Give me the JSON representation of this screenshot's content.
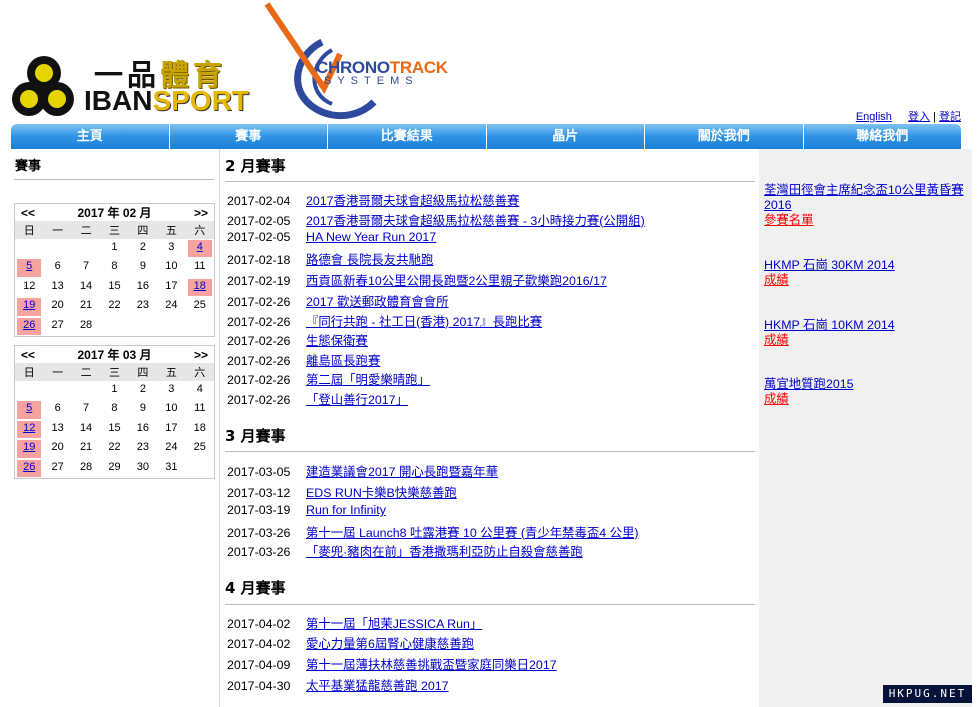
{
  "brand": {
    "iban_zh_part1": "一品",
    "iban_zh_part2": "體育",
    "iban_en_part1": "IBAN",
    "iban_en_part2": "SPORT",
    "chrono_part1": "CHRONO",
    "chrono_part2": "TRACK",
    "chrono_sub": "SYSTEMS",
    "colors": {
      "nav": "#2f93e4",
      "iban_gold": "#e4b800",
      "chrono_blue": "#2e4a9e",
      "chrono_orange": "#e96a16"
    }
  },
  "top_links": {
    "english": "English",
    "login": "登入",
    "separator": "|",
    "register": "登記"
  },
  "nav": [
    "主頁",
    "賽事",
    "比賽結果",
    "晶片",
    "關於我們",
    "聯絡我們"
  ],
  "left": {
    "heading": "賽事",
    "calendars": [
      {
        "prev": "<<",
        "next": ">>",
        "title": "2017 年 02 月",
        "weekdays": [
          "日",
          "一",
          "二",
          "三",
          "四",
          "五",
          "六"
        ],
        "cells": [
          {
            "d": ""
          },
          {
            "d": ""
          },
          {
            "d": ""
          },
          {
            "d": "1"
          },
          {
            "d": "2"
          },
          {
            "d": "3"
          },
          {
            "d": "4",
            "ev": true
          },
          {
            "d": "5",
            "ev": true
          },
          {
            "d": "6"
          },
          {
            "d": "7"
          },
          {
            "d": "8"
          },
          {
            "d": "9"
          },
          {
            "d": "10"
          },
          {
            "d": "11"
          },
          {
            "d": "12"
          },
          {
            "d": "13"
          },
          {
            "d": "14"
          },
          {
            "d": "15"
          },
          {
            "d": "16"
          },
          {
            "d": "17"
          },
          {
            "d": "18",
            "ev": true
          },
          {
            "d": "19",
            "ev": true
          },
          {
            "d": "20"
          },
          {
            "d": "21"
          },
          {
            "d": "22"
          },
          {
            "d": "23"
          },
          {
            "d": "24"
          },
          {
            "d": "25"
          },
          {
            "d": "26",
            "ev": true
          },
          {
            "d": "27"
          },
          {
            "d": "28"
          },
          {
            "d": ""
          },
          {
            "d": ""
          },
          {
            "d": ""
          },
          {
            "d": ""
          }
        ]
      },
      {
        "prev": "<<",
        "next": ">>",
        "title": "2017 年 03 月",
        "weekdays": [
          "日",
          "一",
          "二",
          "三",
          "四",
          "五",
          "六"
        ],
        "cells": [
          {
            "d": ""
          },
          {
            "d": ""
          },
          {
            "d": ""
          },
          {
            "d": "1"
          },
          {
            "d": "2"
          },
          {
            "d": "3"
          },
          {
            "d": "4"
          },
          {
            "d": "5",
            "ev": true
          },
          {
            "d": "6"
          },
          {
            "d": "7"
          },
          {
            "d": "8"
          },
          {
            "d": "9"
          },
          {
            "d": "10"
          },
          {
            "d": "11"
          },
          {
            "d": "12",
            "ev": true
          },
          {
            "d": "13"
          },
          {
            "d": "14"
          },
          {
            "d": "15"
          },
          {
            "d": "16"
          },
          {
            "d": "17"
          },
          {
            "d": "18"
          },
          {
            "d": "19",
            "ev": true
          },
          {
            "d": "20"
          },
          {
            "d": "21"
          },
          {
            "d": "22"
          },
          {
            "d": "23"
          },
          {
            "d": "24"
          },
          {
            "d": "25"
          },
          {
            "d": "26",
            "ev": true
          },
          {
            "d": "27"
          },
          {
            "d": "28"
          },
          {
            "d": "29"
          },
          {
            "d": "30"
          },
          {
            "d": "31"
          },
          {
            "d": ""
          }
        ]
      }
    ]
  },
  "months": [
    {
      "title": "2 月賽事",
      "events": [
        {
          "date": "2017-02-04",
          "name": "2017香港哥爾夫球會超級馬拉松慈善賽"
        },
        {
          "date": "2017-02-05",
          "name": "2017香港哥爾夫球會超級馬拉松慈善賽 - 3小時接力賽(公開組)"
        },
        {
          "date": "2017-02-05",
          "name": "HA New Year Run 2017"
        },
        {
          "date": "2017-02-18",
          "name": "路德會 長院長友共馳跑"
        },
        {
          "date": "2017-02-19",
          "name": "西貢區新春10公里公開長跑暨2公里親子歡樂跑2016/17"
        },
        {
          "date": "2017-02-26",
          "name": "2017 歡送郵政體育會會所"
        },
        {
          "date": "2017-02-26",
          "name": "『同行共跑 - 社工日(香港) 2017』長跑比賽"
        },
        {
          "date": "2017-02-26",
          "name": "生態保衛賽"
        },
        {
          "date": "2017-02-26",
          "name": "離島區長跑賽"
        },
        {
          "date": "2017-02-26",
          "name": "第二屆「明愛樂晴跑」"
        },
        {
          "date": "2017-02-26",
          "name": "「登山善行2017」"
        }
      ]
    },
    {
      "title": "3 月賽事",
      "events": [
        {
          "date": "2017-03-05",
          "name": "建造業議會2017 開心長跑暨嘉年華"
        },
        {
          "date": "2017-03-12",
          "name": "EDS RUN卡樂B快樂慈善跑"
        },
        {
          "date": "2017-03-19",
          "name": "Run for Infinity"
        },
        {
          "date": "2017-03-26",
          "name": "第十一屆 Launch8 吐露港賽 10 公里賽 (青少年禁毒盃4 公里)"
        },
        {
          "date": "2017-03-26",
          "name": "「麥兜·豬肉在前」香港撒瑪利亞防止自殺會慈善跑"
        }
      ]
    },
    {
      "title": "4 月賽事",
      "events": [
        {
          "date": "2017-04-02",
          "name": "第十一屆「旭茉JESSICA Run」"
        },
        {
          "date": "2017-04-02",
          "name": "愛心力量第6屆腎心健康慈善跑"
        },
        {
          "date": "2017-04-09",
          "name": "第十一屆薄扶林慈善挑戰盃暨家庭同樂日2017"
        },
        {
          "date": "2017-04-30",
          "name": "太平基業猛龍慈善跑 2017"
        }
      ]
    }
  ],
  "right": [
    {
      "title": "荃灣田徑會主席紀念盃10公里黃昏賽2016",
      "sub": "參賽名單"
    },
    {
      "title": "HKMP 石崗 30KM 2014",
      "sub": "成績"
    },
    {
      "title": "HKMP 石崗 10KM 2014",
      "sub": "成績"
    },
    {
      "title": "萬宜地質跑2015",
      "sub": "成績"
    }
  ],
  "watermark": "HKPUG.NET"
}
